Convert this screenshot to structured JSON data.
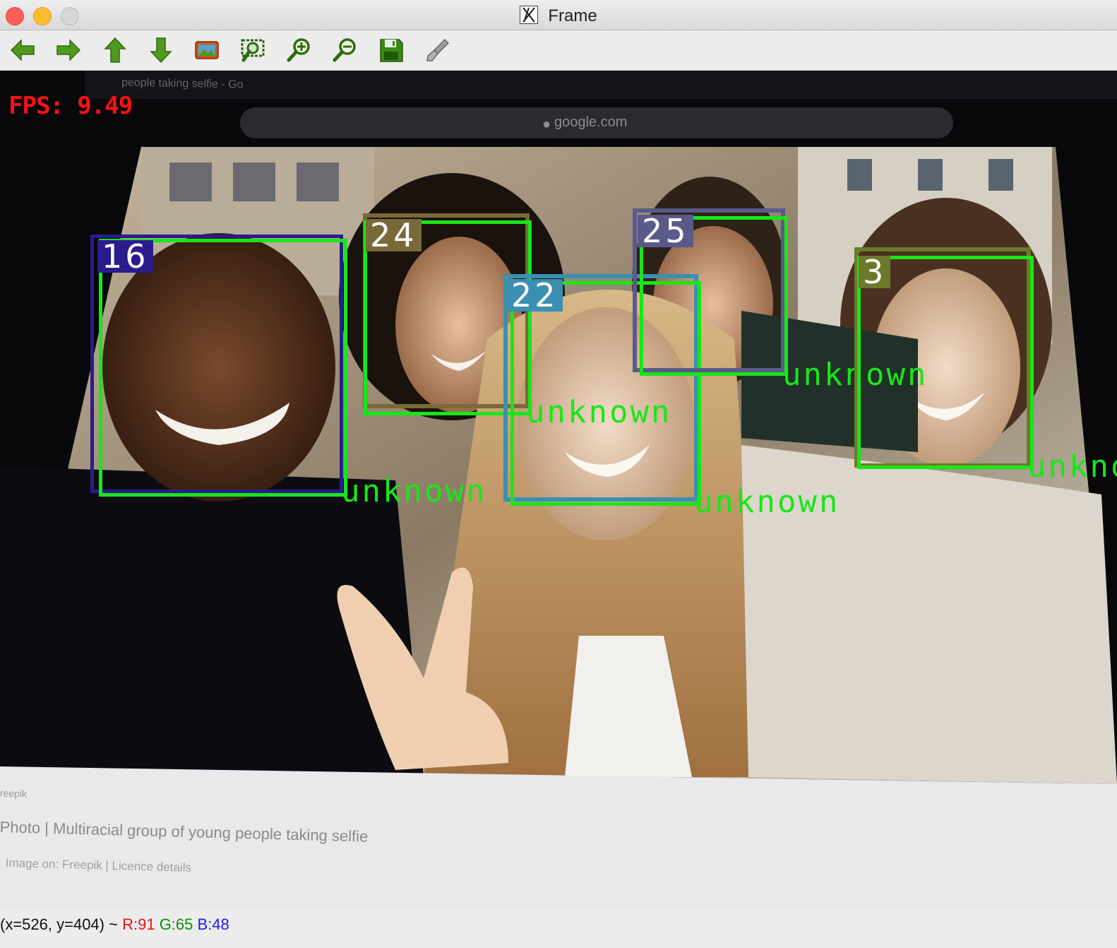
{
  "window": {
    "title": "Frame"
  },
  "toolbar": {
    "buttons": [
      {
        "name": "pan-left-button",
        "icon": "arrow-left-icon"
      },
      {
        "name": "pan-right-button",
        "icon": "arrow-right-icon"
      },
      {
        "name": "pan-up-button",
        "icon": "arrow-up-icon"
      },
      {
        "name": "pan-down-button",
        "icon": "arrow-down-icon"
      },
      {
        "name": "zoom-image-button",
        "icon": "image-icon"
      },
      {
        "name": "zoom-fit-button",
        "icon": "zoom-select-icon"
      },
      {
        "name": "zoom-in-button",
        "icon": "zoom-in-icon"
      },
      {
        "name": "zoom-out-button",
        "icon": "zoom-out-icon"
      },
      {
        "name": "save-button",
        "icon": "save-icon"
      },
      {
        "name": "properties-button",
        "icon": "brush-icon"
      }
    ]
  },
  "overlay": {
    "fps": "FPS: 9.49",
    "faces": [
      {
        "id": "16",
        "label": "unknown",
        "track_color": "#2a1c8c"
      },
      {
        "id": "24",
        "label": "unknown",
        "track_color": "#786a38"
      },
      {
        "id": "22",
        "label": "unknown",
        "track_color": "#3b8fb0"
      },
      {
        "id": "25",
        "label": "unknown",
        "track_color": "#5a5a8a"
      },
      {
        "id": "3",
        "label": "unknown",
        "track_color": "#6a7a2a"
      }
    ],
    "detection_color": "#19e619"
  },
  "background_page": {
    "tab_title": "people taking selfie - Go",
    "url": "google.com",
    "caption": "Photo | Multiracial group of young people taking selfie",
    "source_line": "Image on: Freepik | Licence details",
    "source_small": "reepik"
  },
  "status": {
    "coords": "(x=526, y=404) ~",
    "r": "R:91",
    "g": "G:65",
    "b": "B:48"
  }
}
